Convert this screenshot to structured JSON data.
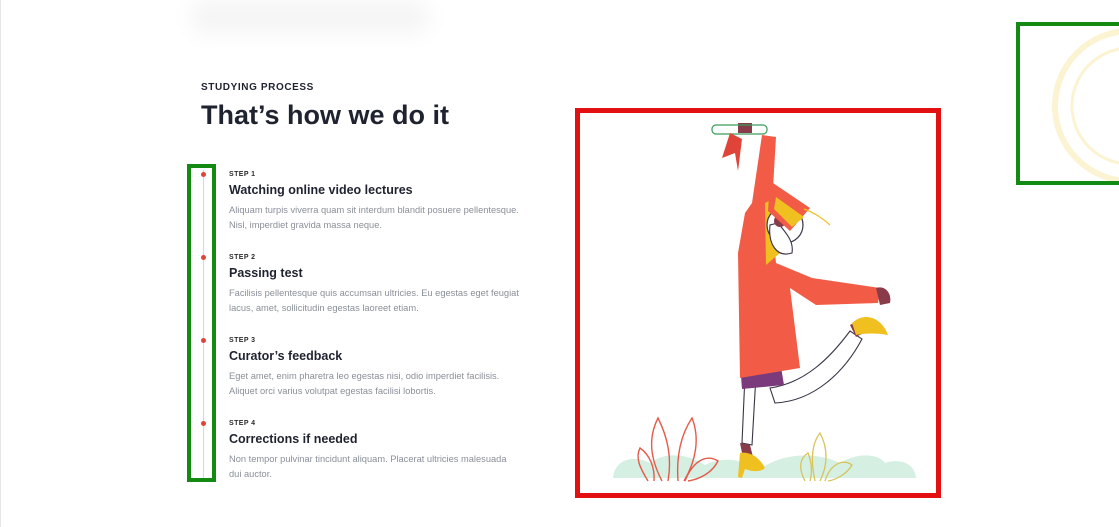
{
  "section": {
    "eyebrow": "STUDYING PROCESS",
    "title": "That’s how we do it"
  },
  "steps": [
    {
      "label": "STEP 1",
      "title": "Watching online video lectures",
      "description": "Aliquam turpis viverra quam sit interdum blandit posuere pellentesque. Nisl, imperdiet gravida massa neque."
    },
    {
      "label": "STEP 2",
      "title": "Passing test",
      "description": "Facilisis pellentesque quis accumsan ultricies. Eu egestas eget feugiat lacus, amet, sollicitudin egestas laoreet etiam."
    },
    {
      "label": "STEP 3",
      "title": "Curator’s feedback",
      "description": "Eget amet, enim pharetra leo egestas nisi, odio imperdiet facilisis. Aliquet orci varius volutpat egestas facilisi lobortis."
    },
    {
      "label": "STEP 4",
      "title": "Corrections if needed",
      "description": "Non tempor pulvinar tincidunt aliquam. Placerat ultricies malesuada dui auctor."
    }
  ],
  "colors": {
    "accent": "#e04438",
    "highlight_green": "#138b13",
    "highlight_red": "#e21010",
    "coat": "#f25b45",
    "deco_ring": "#fbf3d1"
  },
  "icons": {
    "illustration": "graduate-celebrating-illustration",
    "decoration": "concentric-rings-decoration"
  }
}
